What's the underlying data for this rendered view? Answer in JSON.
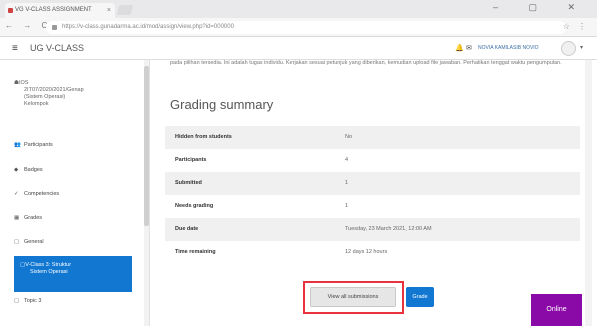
{
  "browser": {
    "tab_title": "VG V-CLASS ASSIGNMENT",
    "tab_close": "×",
    "url": "https://v-class.gunadarma.ac.id/mod/assign/view.php?id=000000",
    "nav": "← → C ⌂",
    "window_controls": "– ▢ ✕",
    "addr_icons": "☆ ⋮"
  },
  "header": {
    "menu_icon": "≡",
    "site_title": "UG V-CLASS",
    "bell": "🔔",
    "message": "✉",
    "user_name": "NOVIA KAMILASIB NOVIO",
    "caret": "▾"
  },
  "sidebar": {
    "course_lines": [
      "IOS",
      "2IT07/2020/2021/Genap",
      "(Sistem Operasi)",
      "Kelompok"
    ],
    "items": [
      {
        "icon": "👥",
        "label": "Participants"
      },
      {
        "icon": "◆",
        "label": "Badges"
      },
      {
        "icon": "✓",
        "label": "Competencies"
      },
      {
        "icon": "▦",
        "label": "Grades"
      },
      {
        "icon": "▢",
        "label": "General"
      }
    ],
    "active_lines": [
      "V-Class 3: Struktur",
      "Sistem Operasi"
    ],
    "active_icon": "▢",
    "next_item": {
      "icon": "▢",
      "label": "Topic 3"
    }
  },
  "main": {
    "intro": "pada pilihan tersedia. Ini adalah tugas individu. Kerjakan sesuai petunjuk yang diberikan, kemudian upload file jawaban. Perhatikan tenggat waktu pengumpulan.",
    "heading": "Grading summary",
    "rows": [
      {
        "k": "Hidden from students",
        "v": "No"
      },
      {
        "k": "Participants",
        "v": "4"
      },
      {
        "k": "Submitted",
        "v": "1"
      },
      {
        "k": "Needs grading",
        "v": "1"
      },
      {
        "k": "Due date",
        "v": "Tuesday, 23 March 2021, 12:00 AM"
      },
      {
        "k": "Time remaining",
        "v": "12 days 12 hours"
      }
    ],
    "view_all_label": "View all submissions",
    "grade_label": "Grade"
  },
  "chat": {
    "label": "Online"
  },
  "colors": {
    "accent": "#1177d1",
    "highlight": "#e8323e",
    "online": "#8a0aa7"
  }
}
